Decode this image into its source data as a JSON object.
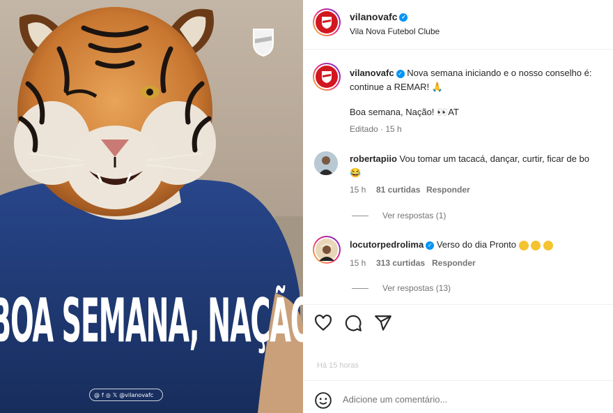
{
  "image": {
    "headline": "BOA SEMANA, NAÇÃO!",
    "social_handle": "@vilanovafc",
    "social_icons": [
      "threads-icon",
      "facebook-icon",
      "instagram-icon",
      "x-icon"
    ]
  },
  "header": {
    "username": "vilanovafc",
    "subtitle": "Vila Nova Futebol Clube"
  },
  "caption": {
    "username": "vilanovafc",
    "text": "Nova semana iniciando e o nosso conselho é: continue a REMAR! 🙏",
    "line2": "Boa semana, Nação! 👀AT",
    "edited": "Editado · 15 h"
  },
  "comments": [
    {
      "username": "robertapiio",
      "text": "Vou tomar um tacacá, dançar, curtir, ficar de bo",
      "text_line2": "😂",
      "time": "15 h",
      "likes": "81 curtidas",
      "reply": "Responder",
      "view_replies": "Ver respostas (1)"
    },
    {
      "username": "locutorpedrolima",
      "text": "Verso do dia Pronto",
      "time": "15 h",
      "likes": "313 curtidas",
      "reply": "Responder",
      "view_replies": "Ver respostas (13)"
    }
  ],
  "actions": {
    "icons": [
      "heart-icon",
      "comment-icon",
      "share-icon"
    ],
    "likes_faded": "Há 15 horas"
  },
  "composer": {
    "placeholder": "Adicione um comentário..."
  },
  "colors": {
    "brand_red": "#d1171f",
    "shirt_blue": "#1f3a73",
    "verified_blue": "#0095f6"
  }
}
